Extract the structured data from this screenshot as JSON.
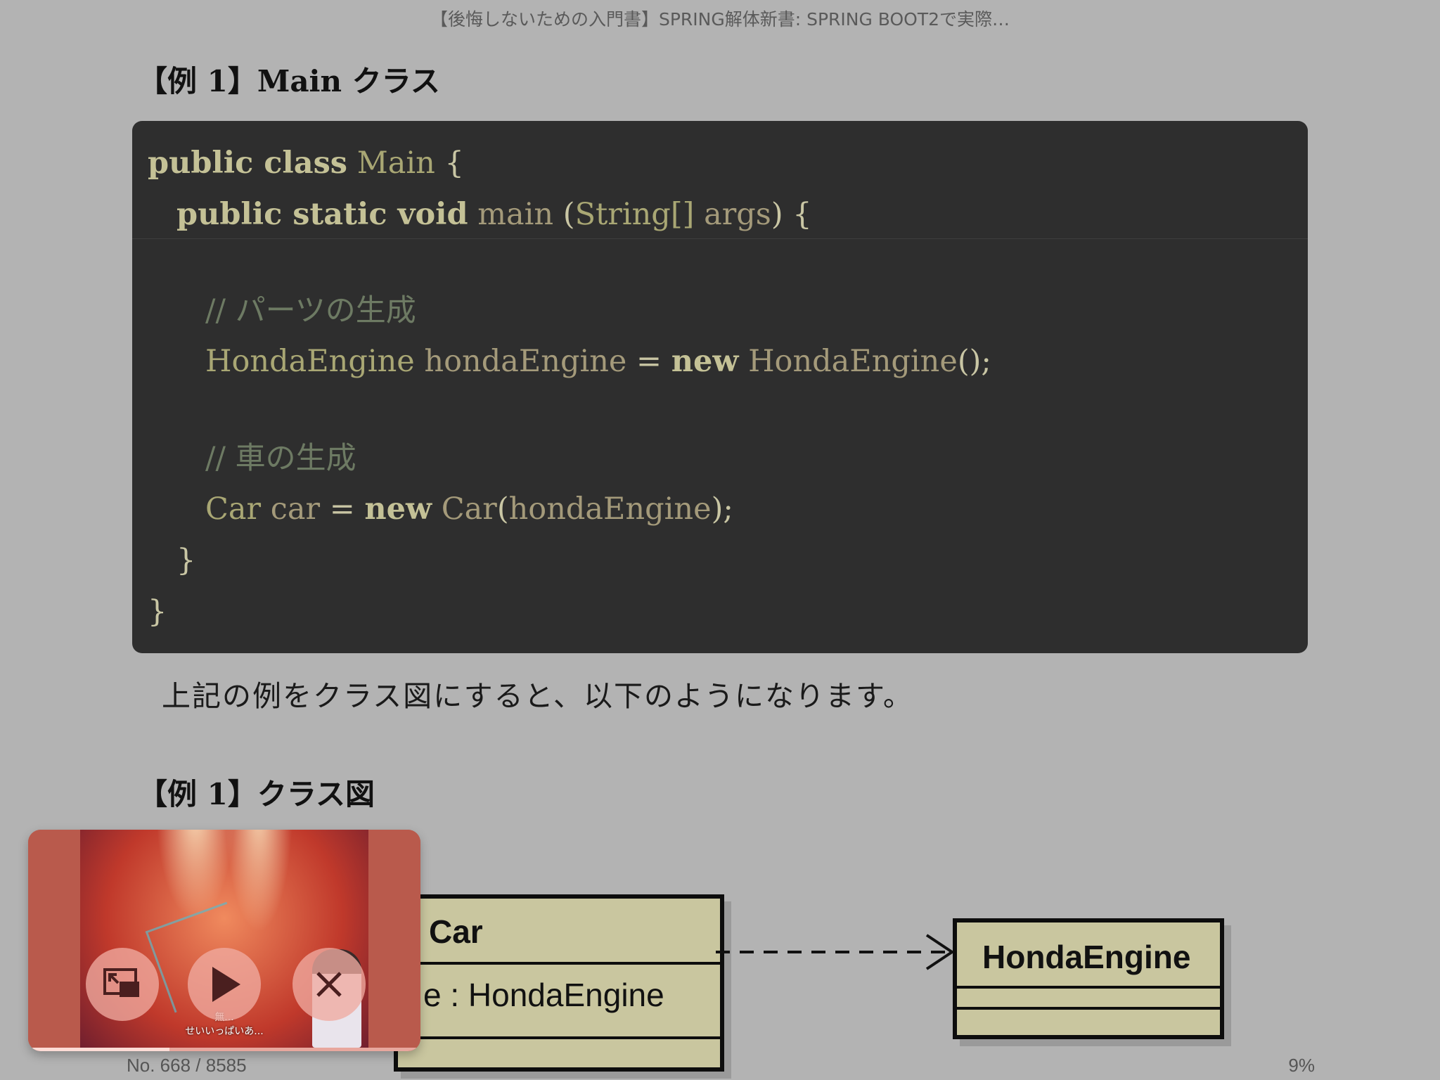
{
  "book": {
    "title": "【後悔しないための入門書】SPRING解体新書: SPRING BOOT2で実際…"
  },
  "section1": {
    "heading": "【例 1】Main クラス"
  },
  "code": {
    "l1": {
      "kw": "public class",
      "name": "Main",
      "tail": "{"
    },
    "l2": {
      "kw": "public static void",
      "name": "main",
      "open": "(",
      "type": "String[]",
      "arg": "args",
      "tail": ") {"
    },
    "l3": {
      "comment": "// パーツの生成"
    },
    "l4": {
      "type1": "HondaEngine",
      "var": "hondaEngine",
      "eq": "=",
      "kw": "new",
      "type2": "HondaEngine",
      "tail": "();"
    },
    "l5": {
      "comment": "// 車の生成"
    },
    "l6": {
      "type1": "Car",
      "var": "car",
      "eq": "=",
      "kw": "new",
      "type2": "Car",
      "open": "(",
      "arg": "hondaEngine",
      "tail": ");"
    },
    "l7": "}",
    "l8": "}"
  },
  "prose": "上記の例をクラス図にすると、以下のようになります。",
  "section2": {
    "heading": "【例 1】クラス図"
  },
  "diagram": {
    "car_class": {
      "name": "Car",
      "attribute": "e : HondaEngine"
    },
    "engine_class": {
      "name": "HondaEngine"
    }
  },
  "pip": {
    "subtitle_line1": "無...",
    "subtitle_line2": "せいいっぱいあ...",
    "progress": 0.36,
    "buttons": {
      "expand_icon": "expand-window-icon",
      "play_icon": "play-icon",
      "close_icon": "close-icon"
    }
  },
  "footer": {
    "location": "No. 668 / 8585",
    "percent": "9%"
  },
  "colors": {
    "page_background": "#b3b3b3",
    "code_background": "#2e2e2e",
    "uml_fill": "#c9c69f"
  }
}
